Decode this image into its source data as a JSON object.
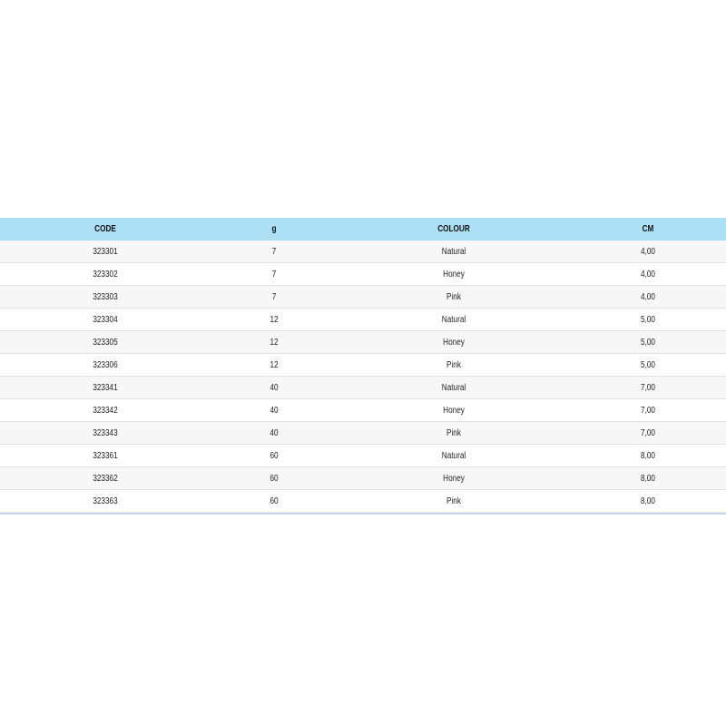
{
  "table": {
    "headers": [
      "CODE",
      "g",
      "COLOUR",
      "CM"
    ],
    "rows": [
      [
        "323301",
        "7",
        "Natural",
        "4,00"
      ],
      [
        "323302",
        "7",
        "Honey",
        "4,00"
      ],
      [
        "323303",
        "7",
        "Pink",
        "4,00"
      ],
      [
        "323304",
        "12",
        "Natural",
        "5,00"
      ],
      [
        "323305",
        "12",
        "Honey",
        "5,00"
      ],
      [
        "323306",
        "12",
        "Pink",
        "5,00"
      ],
      [
        "323341",
        "40",
        "Natural",
        "7,00"
      ],
      [
        "323342",
        "40",
        "Honey",
        "7,00"
      ],
      [
        "323343",
        "40",
        "Pink",
        "7,00"
      ],
      [
        "323361",
        "60",
        "Natural",
        "8,00"
      ],
      [
        "323362",
        "60",
        "Honey",
        "8,00"
      ],
      [
        "323363",
        "60",
        "Pink",
        "8,00"
      ]
    ]
  },
  "colors": {
    "header_background": "#ade0f5",
    "row_stripe": "#f7f7f7",
    "row_background": "#ffffff"
  }
}
